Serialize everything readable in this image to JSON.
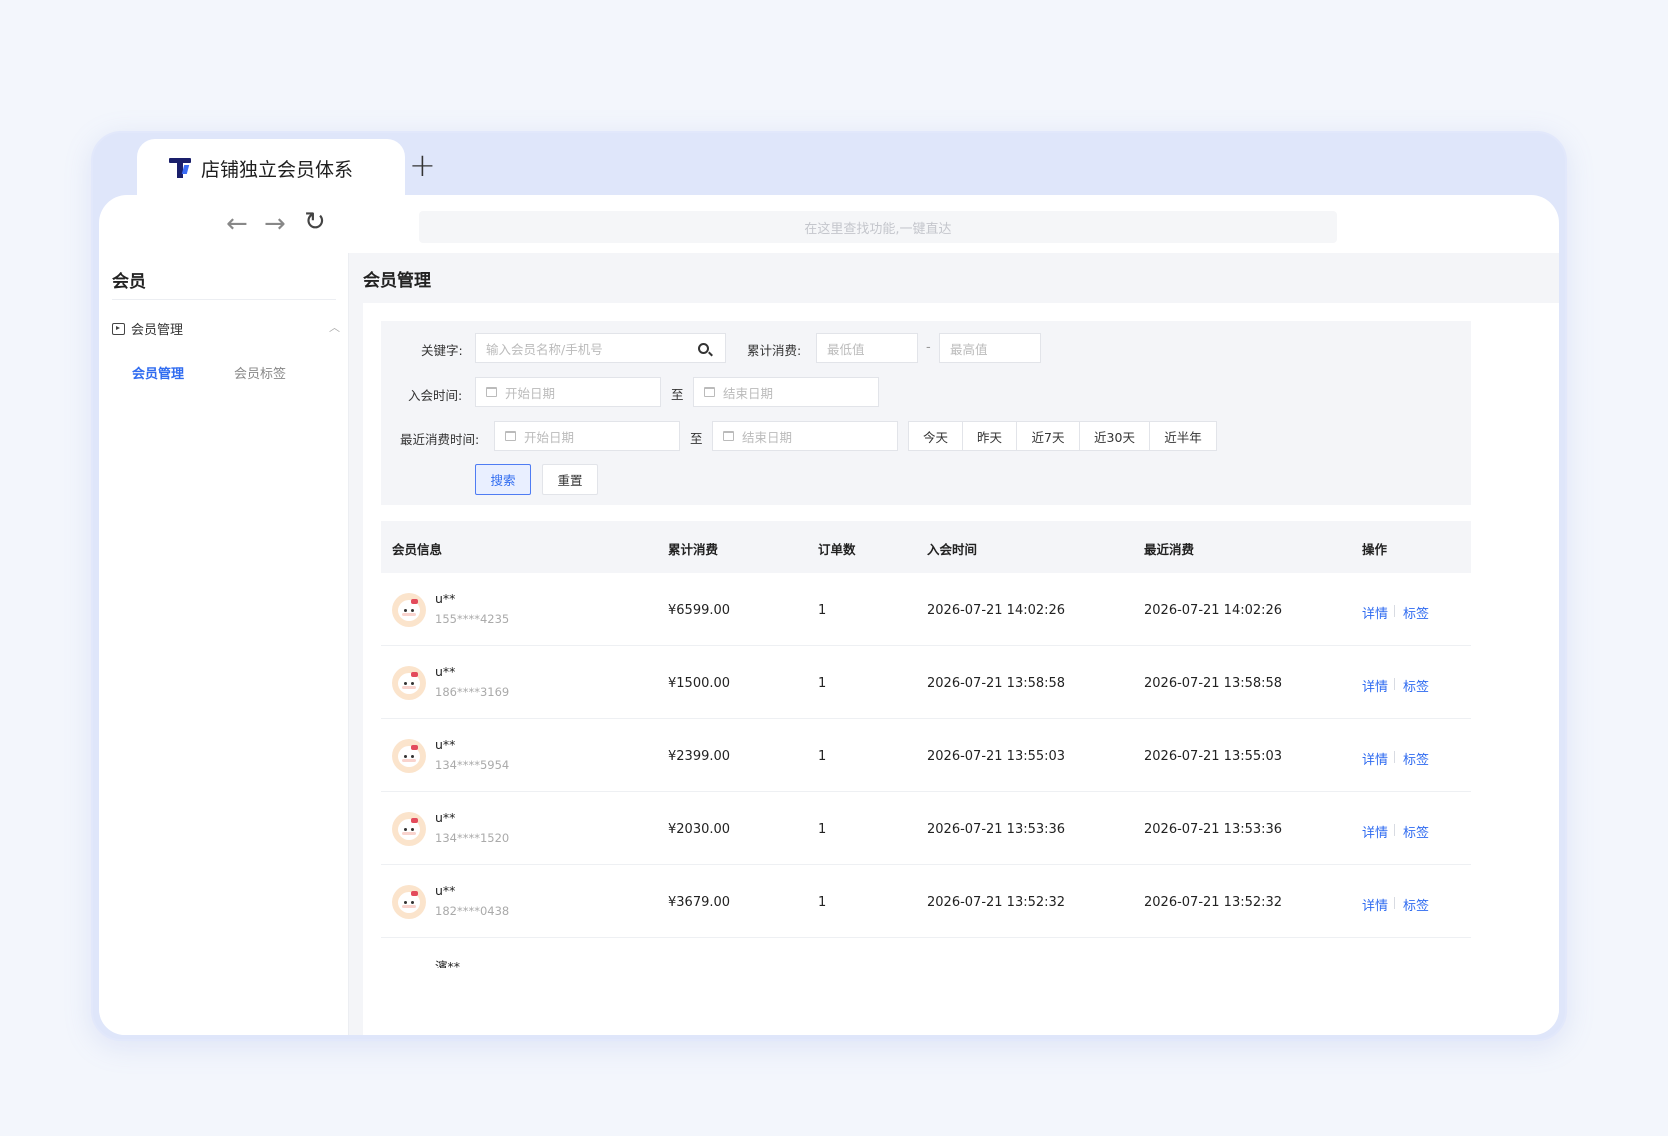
{
  "tab": {
    "title": "店铺独立会员体系",
    "new_tab": "+"
  },
  "toolbar": {
    "back": "←",
    "forward": "→",
    "reload": "↻",
    "search_placeholder": "在这里查找功能,一键直达"
  },
  "sidebar": {
    "title": "会员",
    "group_label": "会员管理",
    "group_chevron": "︿",
    "items": [
      {
        "label": "会员管理",
        "active": true
      },
      {
        "label": "会员标签",
        "active": false
      }
    ]
  },
  "main": {
    "page_title": "会员管理"
  },
  "filters": {
    "keyword_label": "关键字:",
    "keyword_placeholder": "输入会员名称/手机号",
    "spend_label": "累计消费:",
    "spend_min_placeholder": "最低值",
    "spend_dash": "-",
    "spend_max_placeholder": "最高值",
    "join_label": "入会时间:",
    "start_placeholder": "开始日期",
    "to_label": "至",
    "end_placeholder": "结束日期",
    "recent_label": "最近消费时间:",
    "quick_ranges": [
      "今天",
      "昨天",
      "近7天",
      "近30天",
      "近半年"
    ],
    "search_button": "搜索",
    "reset_button": "重置"
  },
  "table": {
    "columns": [
      "会员信息",
      "累计消费",
      "订单数",
      "入会时间",
      "最近消费",
      "操作"
    ],
    "action_detail": "详情",
    "action_tag": "标签",
    "rows": [
      {
        "name": "u**",
        "phone": "155****4235",
        "spend": "¥6599.00",
        "orders": "1",
        "joined": "2026-07-21 14:02:26",
        "last": "2026-07-21 14:02:26"
      },
      {
        "name": "u**",
        "phone": "186****3169",
        "spend": "¥1500.00",
        "orders": "1",
        "joined": "2026-07-21 13:58:58",
        "last": "2026-07-21 13:58:58"
      },
      {
        "name": "u**",
        "phone": "134****5954",
        "spend": "¥2399.00",
        "orders": "1",
        "joined": "2026-07-21 13:55:03",
        "last": "2026-07-21 13:55:03"
      },
      {
        "name": "u**",
        "phone": "134****1520",
        "spend": "¥2030.00",
        "orders": "1",
        "joined": "2026-07-21 13:53:36",
        "last": "2026-07-21 13:53:36"
      },
      {
        "name": "u**",
        "phone": "182****0438",
        "spend": "¥3679.00",
        "orders": "1",
        "joined": "2026-07-21 13:52:32",
        "last": "2026-07-21 13:52:32"
      }
    ],
    "partial_row_name": "濱**"
  }
}
